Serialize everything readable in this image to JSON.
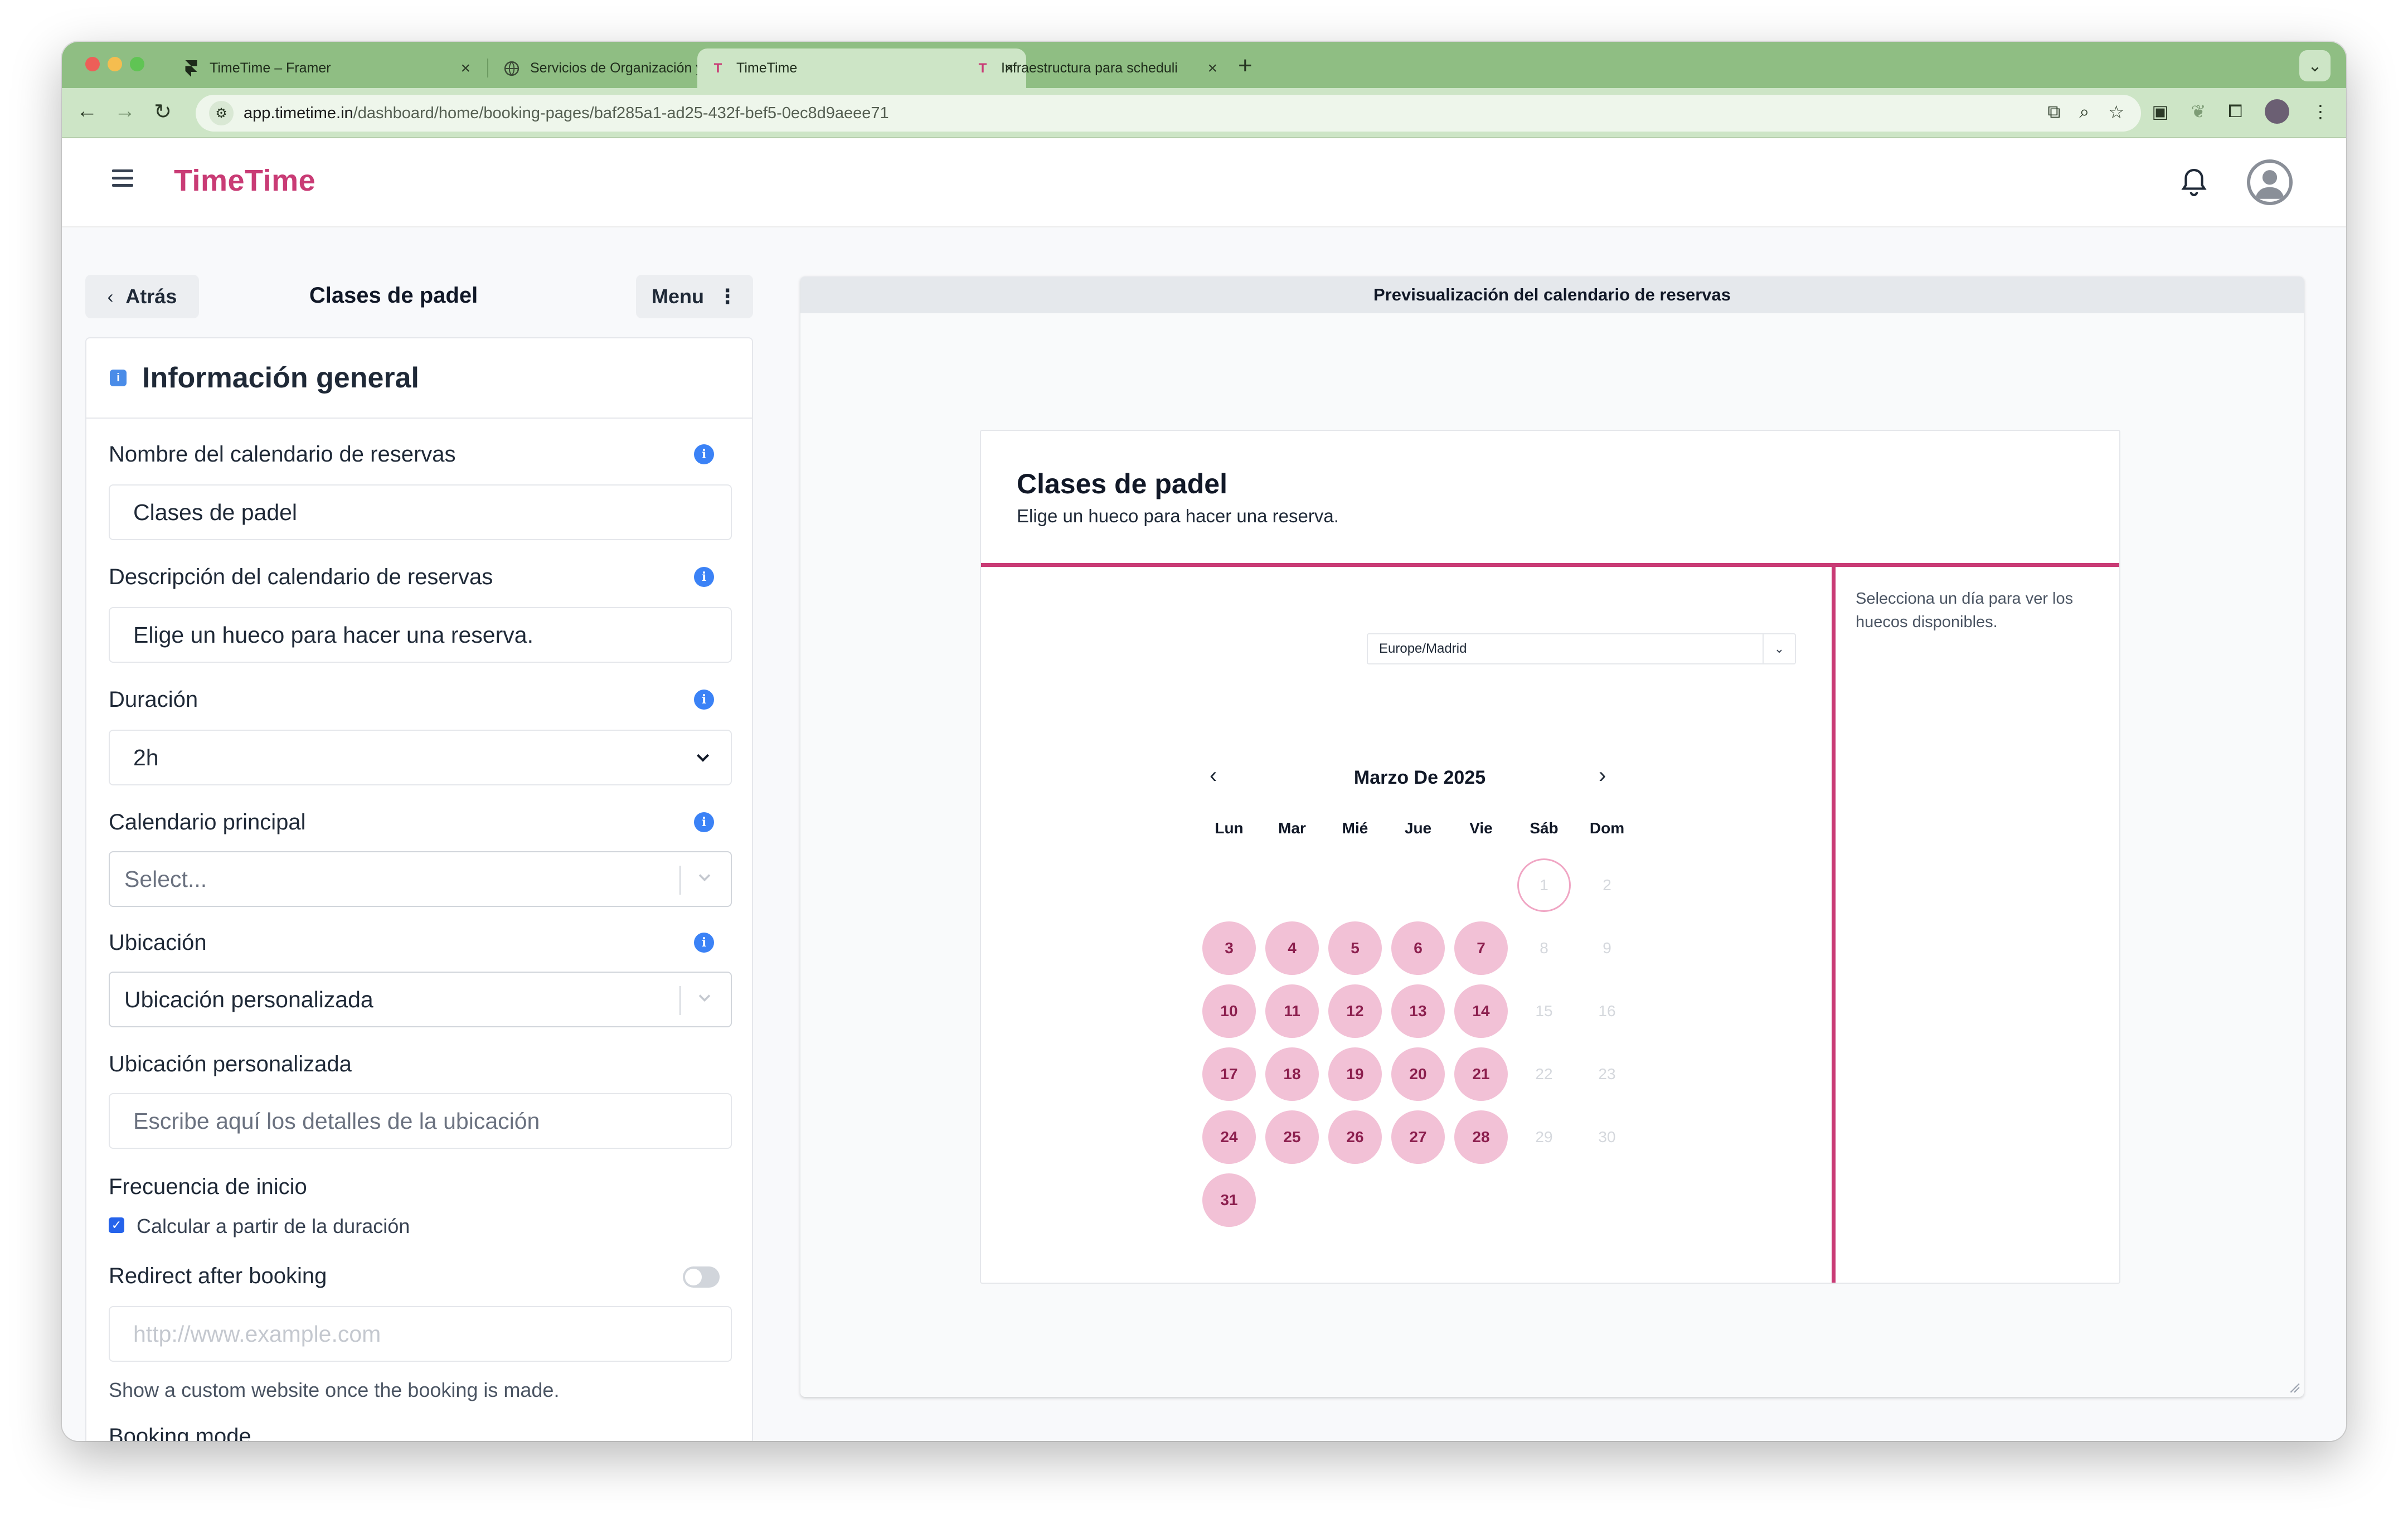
{
  "browser": {
    "tabs": [
      {
        "title": "TimeTime – Framer",
        "favicon": "framer-icon"
      },
      {
        "title": "Servicios de Organización y D",
        "favicon": "globe-icon"
      },
      {
        "title": "TimeTime",
        "favicon": "timetime-icon"
      },
      {
        "title": "Infraestructura para scheduli",
        "favicon": "timetime-icon"
      }
    ],
    "favicon_letter": "T",
    "url_host": "app.timetime.in",
    "url_path": "/dashboard/home/booking-pages/baf285a1-ad25-432f-bef5-0ec8d9aeee71",
    "colors": {
      "tabbar": "#8fbe83",
      "active_tab": "#cde5c6"
    }
  },
  "app": {
    "logo": "TimeTime",
    "brand_color": "#c93b75"
  },
  "panel": {
    "back_label": "Atrás",
    "title": "Clases de padel",
    "menu_label": "Menu"
  },
  "form": {
    "section_title": "Información general",
    "name_label": "Nombre del calendario de reservas",
    "name_value": "Clases de padel",
    "description_label": "Descripción del calendario de reservas",
    "description_value": "Elige un hueco para hacer una reserva.",
    "duration_label": "Duración",
    "duration_value": "2h",
    "main_calendar_label": "Calendario principal",
    "main_calendar_placeholder": "Select...",
    "location_label": "Ubicación",
    "location_value": "Ubicación personalizada",
    "custom_location_label": "Ubicación personalizada",
    "custom_location_placeholder": "Escribe aquí los detalles de la ubicación",
    "start_frequency_label": "Frecuencia de inicio",
    "start_frequency_checkbox": "Calcular a partir de la duración",
    "start_frequency_checked": true,
    "redirect_label": "Redirect after booking",
    "redirect_enabled": false,
    "redirect_placeholder": "http://www.example.com",
    "redirect_help": "Show a custom website once the booking is made.",
    "booking_mode_label": "Booking mode",
    "info_icon_glyph": "i"
  },
  "preview": {
    "bar_title": "Previsualización del calendario de reservas",
    "booking_title": "Clases de padel",
    "booking_description": "Elige un hueco para hacer una reserva.",
    "side_hint": "Selecciona un día para ver los huecos disponibles.",
    "timezone": "Europe/Madrid",
    "month_label": "Marzo De 2025",
    "prev_glyph": "‹",
    "next_glyph": "›",
    "weekdays": [
      "Lun",
      "Mar",
      "Mié",
      "Jue",
      "Vie",
      "Sáb",
      "Dom"
    ],
    "days": [
      {
        "d": "1",
        "state": "today"
      },
      {
        "d": "2",
        "state": "off"
      },
      {
        "d": "3",
        "state": "avail"
      },
      {
        "d": "4",
        "state": "avail"
      },
      {
        "d": "5",
        "state": "avail"
      },
      {
        "d": "6",
        "state": "avail"
      },
      {
        "d": "7",
        "state": "avail"
      },
      {
        "d": "8",
        "state": "off"
      },
      {
        "d": "9",
        "state": "off"
      },
      {
        "d": "10",
        "state": "avail"
      },
      {
        "d": "11",
        "state": "avail"
      },
      {
        "d": "12",
        "state": "avail"
      },
      {
        "d": "13",
        "state": "avail"
      },
      {
        "d": "14",
        "state": "avail"
      },
      {
        "d": "15",
        "state": "off"
      },
      {
        "d": "16",
        "state": "off"
      },
      {
        "d": "17",
        "state": "avail"
      },
      {
        "d": "18",
        "state": "avail"
      },
      {
        "d": "19",
        "state": "avail"
      },
      {
        "d": "20",
        "state": "avail"
      },
      {
        "d": "21",
        "state": "avail"
      },
      {
        "d": "22",
        "state": "off"
      },
      {
        "d": "23",
        "state": "off"
      },
      {
        "d": "24",
        "state": "avail"
      },
      {
        "d": "25",
        "state": "avail"
      },
      {
        "d": "26",
        "state": "avail"
      },
      {
        "d": "27",
        "state": "avail"
      },
      {
        "d": "28",
        "state": "avail"
      },
      {
        "d": "29",
        "state": "off"
      },
      {
        "d": "30",
        "state": "off"
      },
      {
        "d": "31",
        "state": "avail"
      }
    ],
    "first_weekday_index": 5,
    "available_color": "#f2c1d6"
  }
}
